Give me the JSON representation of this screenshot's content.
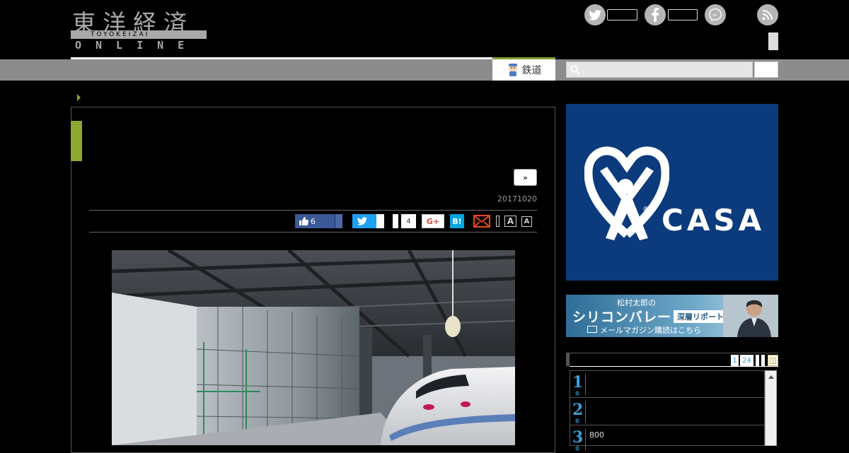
{
  "header": {
    "logo_kanji": "東洋経済",
    "logo_band": "TOYOKEIZAI",
    "logo_online": "ONLINE",
    "social": [
      {
        "name": "twitter",
        "icon": "twitter-icon"
      },
      {
        "name": "facebook",
        "icon": "facebook-icon"
      },
      {
        "name": "messenger",
        "icon": "messenger-icon"
      }
    ],
    "rss_icon": "rss-icon"
  },
  "nav": {
    "active_tab_label": "鉄道",
    "active_tab_color": "#7fa032",
    "search_placeholder": ""
  },
  "article": {
    "next_button_label": "»",
    "date": "20171020",
    "share": {
      "like_count": "6",
      "hatena_count": "4",
      "gplus_label": "G+",
      "hatena_label": "B!",
      "font_large": "A",
      "font_small": "A"
    },
    "accent_color": "#8ba82f"
  },
  "sidebar": {
    "ad_casa": {
      "brand": "CASA",
      "reg_mark": "®",
      "bg_color": "#0b3b7c"
    },
    "ad_silicon": {
      "line1": "松村太郎の",
      "line2": "シリコンバレー",
      "tag": "深層リポート",
      "line3": "メールマガジン購読はこちら"
    },
    "ranking": {
      "tabs": [
        "1",
        "24"
      ],
      "rows": [
        {
          "rank": "1",
          "suffix": "位",
          "title": ""
        },
        {
          "rank": "2",
          "suffix": "位",
          "title": ""
        },
        {
          "rank": "3",
          "suffix": "位",
          "title": "800"
        }
      ]
    }
  }
}
